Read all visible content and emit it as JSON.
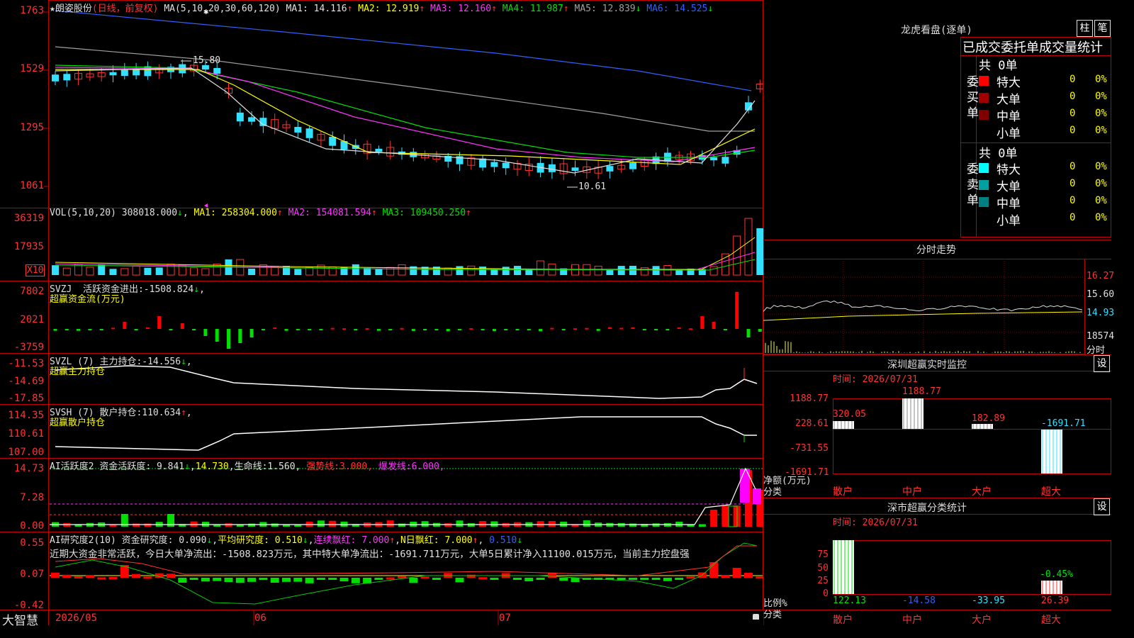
{
  "stock": {
    "star": "★",
    "name": "朗姿股份",
    "period": "(日线，前复权)",
    "ma_title": "MA(5,10,20,30,60,120)",
    "ma": [
      {
        "label": "MA1:",
        "value": "14.116",
        "arrow": "↑",
        "color": "#e0e0e0"
      },
      {
        "label": "MA2:",
        "value": "12.919",
        "arrow": "↑",
        "color": "#ffff00"
      },
      {
        "label": "MA3:",
        "value": "12.160",
        "arrow": "↑",
        "color": "#ff33ff"
      },
      {
        "label": "MA4:",
        "value": "11.987",
        "arrow": "↑",
        "color": "#00e000"
      },
      {
        "label": "MA5:",
        "value": "12.839",
        "arrow": "↓",
        "color": "#a0a0a0"
      },
      {
        "label": "MA6:",
        "value": "14.525",
        "arrow": "↓",
        "color": "#3060ff"
      }
    ],
    "high_label": "15.80",
    "low_label": "10.61",
    "price_axis": [
      "1763",
      "1529",
      "1295",
      "1061"
    ]
  },
  "vol": {
    "title": "VOL(5,10,20)",
    "value": "308018.000",
    "arrow": "↓",
    "ma": [
      {
        "label": "MA1:",
        "value": "258304.000",
        "arrow": "↑",
        "color": "#ffff00"
      },
      {
        "label": "MA2:",
        "value": "154081.594",
        "arrow": "↑",
        "color": "#ff33ff"
      },
      {
        "label": "MA3:",
        "value": "109450.250",
        "arrow": "↑",
        "color": "#00e000"
      }
    ],
    "axis": [
      "36319",
      "17935"
    ],
    "unit": "X10"
  },
  "svzj": {
    "title": "SVZJ",
    "label": "活跃资金进出:",
    "value": "-1508.824",
    "arrow": "↓",
    "comma": ",",
    "sub": "超赢资金流(万元)",
    "axis": [
      "7802",
      "2021",
      "-3759"
    ]
  },
  "svzl": {
    "title": "SVZL (7)",
    "label": "主力持仓:",
    "value": "-14.556",
    "arrow": "↓",
    "comma": ",",
    "sub": "超赢主力持仓",
    "axis": [
      "-11.53",
      "-14.69",
      "-17.85"
    ]
  },
  "svsh": {
    "title": "SVSH (7)",
    "label": "散户持仓:",
    "value": "110.634",
    "arrow": "↑",
    "comma": ",",
    "sub": "超赢散户持仓",
    "axis": [
      "114.35",
      "110.61",
      "107.00"
    ]
  },
  "ai_active": {
    "title": "AI活跃度2",
    "label": "资金活跃度:",
    "value": "9.841",
    "arrow": "↓",
    "comma": ",",
    "v2": "14.730",
    "comma2": ",",
    "life": "生命线:",
    "life_v": "1.560",
    "comma3": ",",
    "strong": "强势线:",
    "strong_v": "3.000",
    "comma4": ",",
    "burst": "爆发线:",
    "burst_v": "6.000",
    "comma5": ",",
    "axis": [
      "14.73",
      "7.28",
      "0.00"
    ]
  },
  "ai_research": {
    "title": "AI研究度2(10)",
    "label": "资金研究度:",
    "value": "0.090",
    "arrow": "↓",
    "comma": ",",
    "avg": "平均研究度:",
    "avg_v": "0.510",
    "arrow2": "↓",
    "comma2": ",",
    "red": "连续飘红:",
    "red_v": "7.000",
    "arrow3": "↑",
    "comma3": ",",
    "nred": "N日飘红:",
    "nred_v": "7.000",
    "arrow4": "↑",
    "comma4": ",",
    "last_v": "0.510",
    "arrow5": "↓",
    "summary": "近期大资金非常活跃，今日大单净流出：-1508.823万元，其中特大单净流出：-1691.711万元，大单5日累计净入11100.015万元，当前主力控盘强",
    "axis": [
      "0.55",
      "0.07",
      "-0.42"
    ]
  },
  "xaxis": {
    "brand": "大智慧",
    "dates": [
      "2026/05",
      "06",
      "07"
    ]
  },
  "lhb": {
    "title": "龙虎看盘(逐单)",
    "btn1": "柱",
    "btn2": "笔",
    "header": "已成交委托单成交量统计",
    "buy": {
      "side": "委买单",
      "total": "共 0单",
      "rows": [
        {
          "name": "特大",
          "n": "0",
          "p": "0%",
          "color": "#ff0000"
        },
        {
          "name": "大单",
          "n": "0",
          "p": "0%",
          "color": "#a00000"
        },
        {
          "name": "中单",
          "n": "0",
          "p": "0%",
          "color": "#800000"
        },
        {
          "name": "小单",
          "n": "0",
          "p": "0%",
          "color": ""
        }
      ]
    },
    "sell": {
      "side": "委卖单",
      "total": "共 0单",
      "rows": [
        {
          "name": "特大",
          "n": "0",
          "p": "0%",
          "color": "#00ffff"
        },
        {
          "name": "大单",
          "n": "0",
          "p": "0%",
          "color": "#00a0a0"
        },
        {
          "name": "中单",
          "n": "0",
          "p": "0%",
          "color": "#008080"
        },
        {
          "name": "小单",
          "n": "0",
          "p": "0%",
          "color": ""
        }
      ]
    }
  },
  "fenshi": {
    "title": "分时走势",
    "axis": [
      "16.27",
      "15.60",
      "14.93",
      "18574"
    ],
    "unit": "分时"
  },
  "sz_monitor": {
    "title": "深圳超赢实时监控",
    "btn": "设",
    "time": "时间: 2026/07/31",
    "axis": [
      "1188.77",
      "228.61",
      "-731.55",
      "-1691.71"
    ],
    "bars": [
      {
        "label": "320.05",
        "cat": "散户"
      },
      {
        "label": "1188.77",
        "cat": "中户"
      },
      {
        "label": "182.89",
        "cat": "大户"
      },
      {
        "label": "-1691.71",
        "cat": "超大"
      }
    ],
    "unit": "净额(万元)",
    "unit2": "分类"
  },
  "sz_class": {
    "title": "深市超赢分类统计",
    "btn": "设",
    "time": "时间: 2026/07/31",
    "axis": [
      "75",
      "50",
      "25",
      "0"
    ],
    "bars": [
      {
        "label": "122.13",
        "cat": "散户",
        "lcolor": "#00e000"
      },
      {
        "label": "-14.58",
        "cat": "中户",
        "lcolor": "#3060ff"
      },
      {
        "label": "-33.95",
        "cat": "大户",
        "lcolor": "#33e0ff"
      },
      {
        "label": "26.39",
        "cat": "超大",
        "lcolor": "#ff3333"
      }
    ],
    "mid_label": "-0.45%",
    "unit": "比例%",
    "unit2": "分类"
  }
}
